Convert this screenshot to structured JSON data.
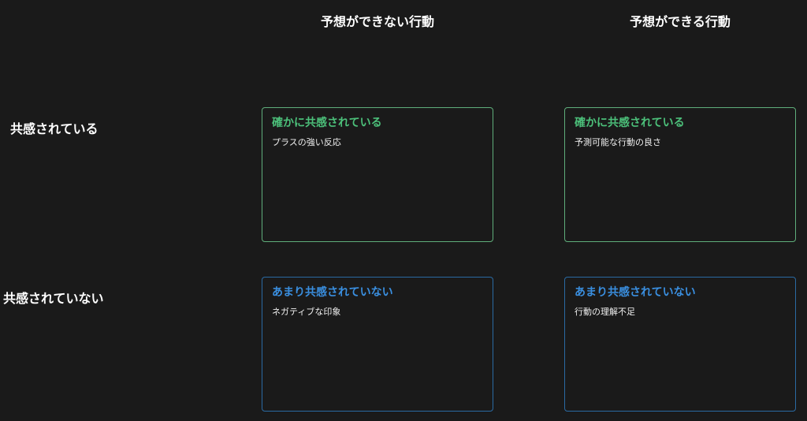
{
  "columns": {
    "unpredictable": "予想ができない行動",
    "predictable": "予想ができる行動"
  },
  "rows": {
    "empathized": "共感されている",
    "not_empathized": "共感されていない"
  },
  "cells": {
    "empathized_unpredictable": {
      "title": "確かに共感されている",
      "body": "プラスの強い反応"
    },
    "empathized_predictable": {
      "title": "確かに共感されている",
      "body": "予測可能な行動の良さ"
    },
    "not_empathized_unpredictable": {
      "title": "あまり共感されていない",
      "body": "ネガティブな印象"
    },
    "not_empathized_predictable": {
      "title": "あまり共感されていない",
      "body": "行動の理解不足"
    }
  },
  "colors": {
    "background": "#1a1a1a",
    "agree_border": "#5fae7b",
    "agree_title": "#4cc07a",
    "disagree_border": "#2a6aa3",
    "disagree_title": "#3a8fe0"
  }
}
